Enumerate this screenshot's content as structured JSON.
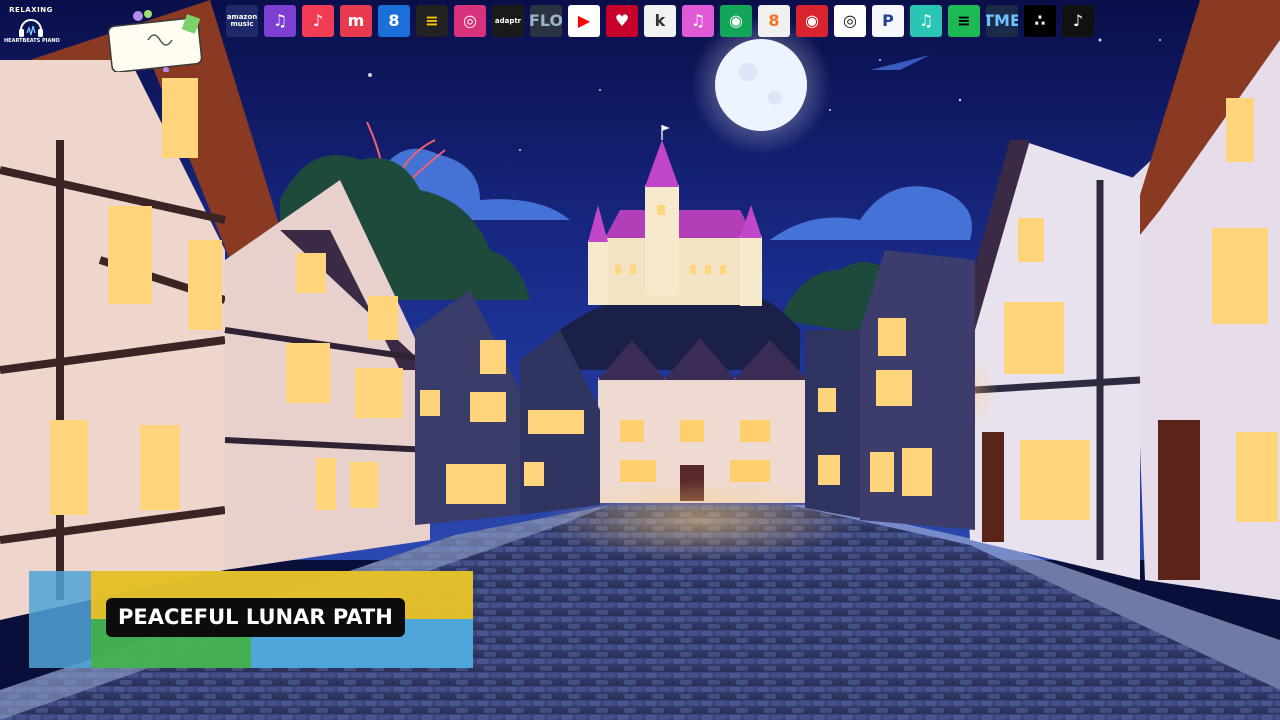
{
  "channel": {
    "logo_top": "RELAXING",
    "logo_bottom": "HEARTBEATS PIANO"
  },
  "video_title": "PEACEFUL LUNAR PATH",
  "platforms": [
    {
      "name": "amazon-music",
      "label": "amazon music",
      "bg": "#1f2a6b",
      "fg": "#ffffff"
    },
    {
      "name": "napster",
      "label": "♫",
      "bg": "#7c3fd1",
      "fg": "#ffffff"
    },
    {
      "name": "apple-music",
      "label": "♪",
      "bg": "#f23b55",
      "fg": "#ffffff"
    },
    {
      "name": "melon",
      "label": "m",
      "bg": "#e83a4f",
      "fg": "#ffffff"
    },
    {
      "name": "shazam",
      "label": "8",
      "bg": "#1b6fd8",
      "fg": "#ffffff"
    },
    {
      "name": "deezer",
      "label": "≡",
      "bg": "#222222",
      "fg": "#f9c30c"
    },
    {
      "name": "instagram",
      "label": "◎",
      "bg": "#d9327c",
      "fg": "#ffffff"
    },
    {
      "name": "adaptr",
      "label": "adaptr",
      "bg": "#1a1a1a",
      "fg": "#ffffff"
    },
    {
      "name": "flo",
      "label": "FLO",
      "bg": "#2b3340",
      "fg": "#9fb3c8"
    },
    {
      "name": "youtube-music",
      "label": "▶",
      "bg": "#ffffff",
      "fg": "#ff0000"
    },
    {
      "name": "iheartradio",
      "label": "♥",
      "bg": "#c6002b",
      "fg": "#ffffff"
    },
    {
      "name": "kkbox",
      "label": "k",
      "bg": "#f2f2f2",
      "fg": "#333333"
    },
    {
      "name": "itunes",
      "label": "♫",
      "bg": "#e05ad6",
      "fg": "#ffffff"
    },
    {
      "name": "anghami",
      "label": "◉",
      "bg": "#13a55a",
      "fg": "#ffffff"
    },
    {
      "name": "soundcloud-8",
      "label": "8",
      "bg": "#f0f0f0",
      "fg": "#f37321"
    },
    {
      "name": "qobuz-red",
      "label": "◉",
      "bg": "#d9232e",
      "fg": "#ffffff"
    },
    {
      "name": "qobuz",
      "label": "◎",
      "bg": "#ffffff",
      "fg": "#111111"
    },
    {
      "name": "pandora",
      "label": "P",
      "bg": "#f5f7fb",
      "fg": "#224099"
    },
    {
      "name": "jiosaavn",
      "label": "♫",
      "bg": "#2bc5b4",
      "fg": "#ffffff"
    },
    {
      "name": "spotify",
      "label": "≡",
      "bg": "#1db954",
      "fg": "#000000"
    },
    {
      "name": "tme",
      "label": "TME",
      "bg": "#1c2a4a",
      "fg": "#6ec1ff"
    },
    {
      "name": "tidal",
      "label": "∴",
      "bg": "#000000",
      "fg": "#ffffff"
    },
    {
      "name": "tiktok",
      "label": "♪",
      "bg": "#111111",
      "fg": "#ffffff"
    }
  ]
}
